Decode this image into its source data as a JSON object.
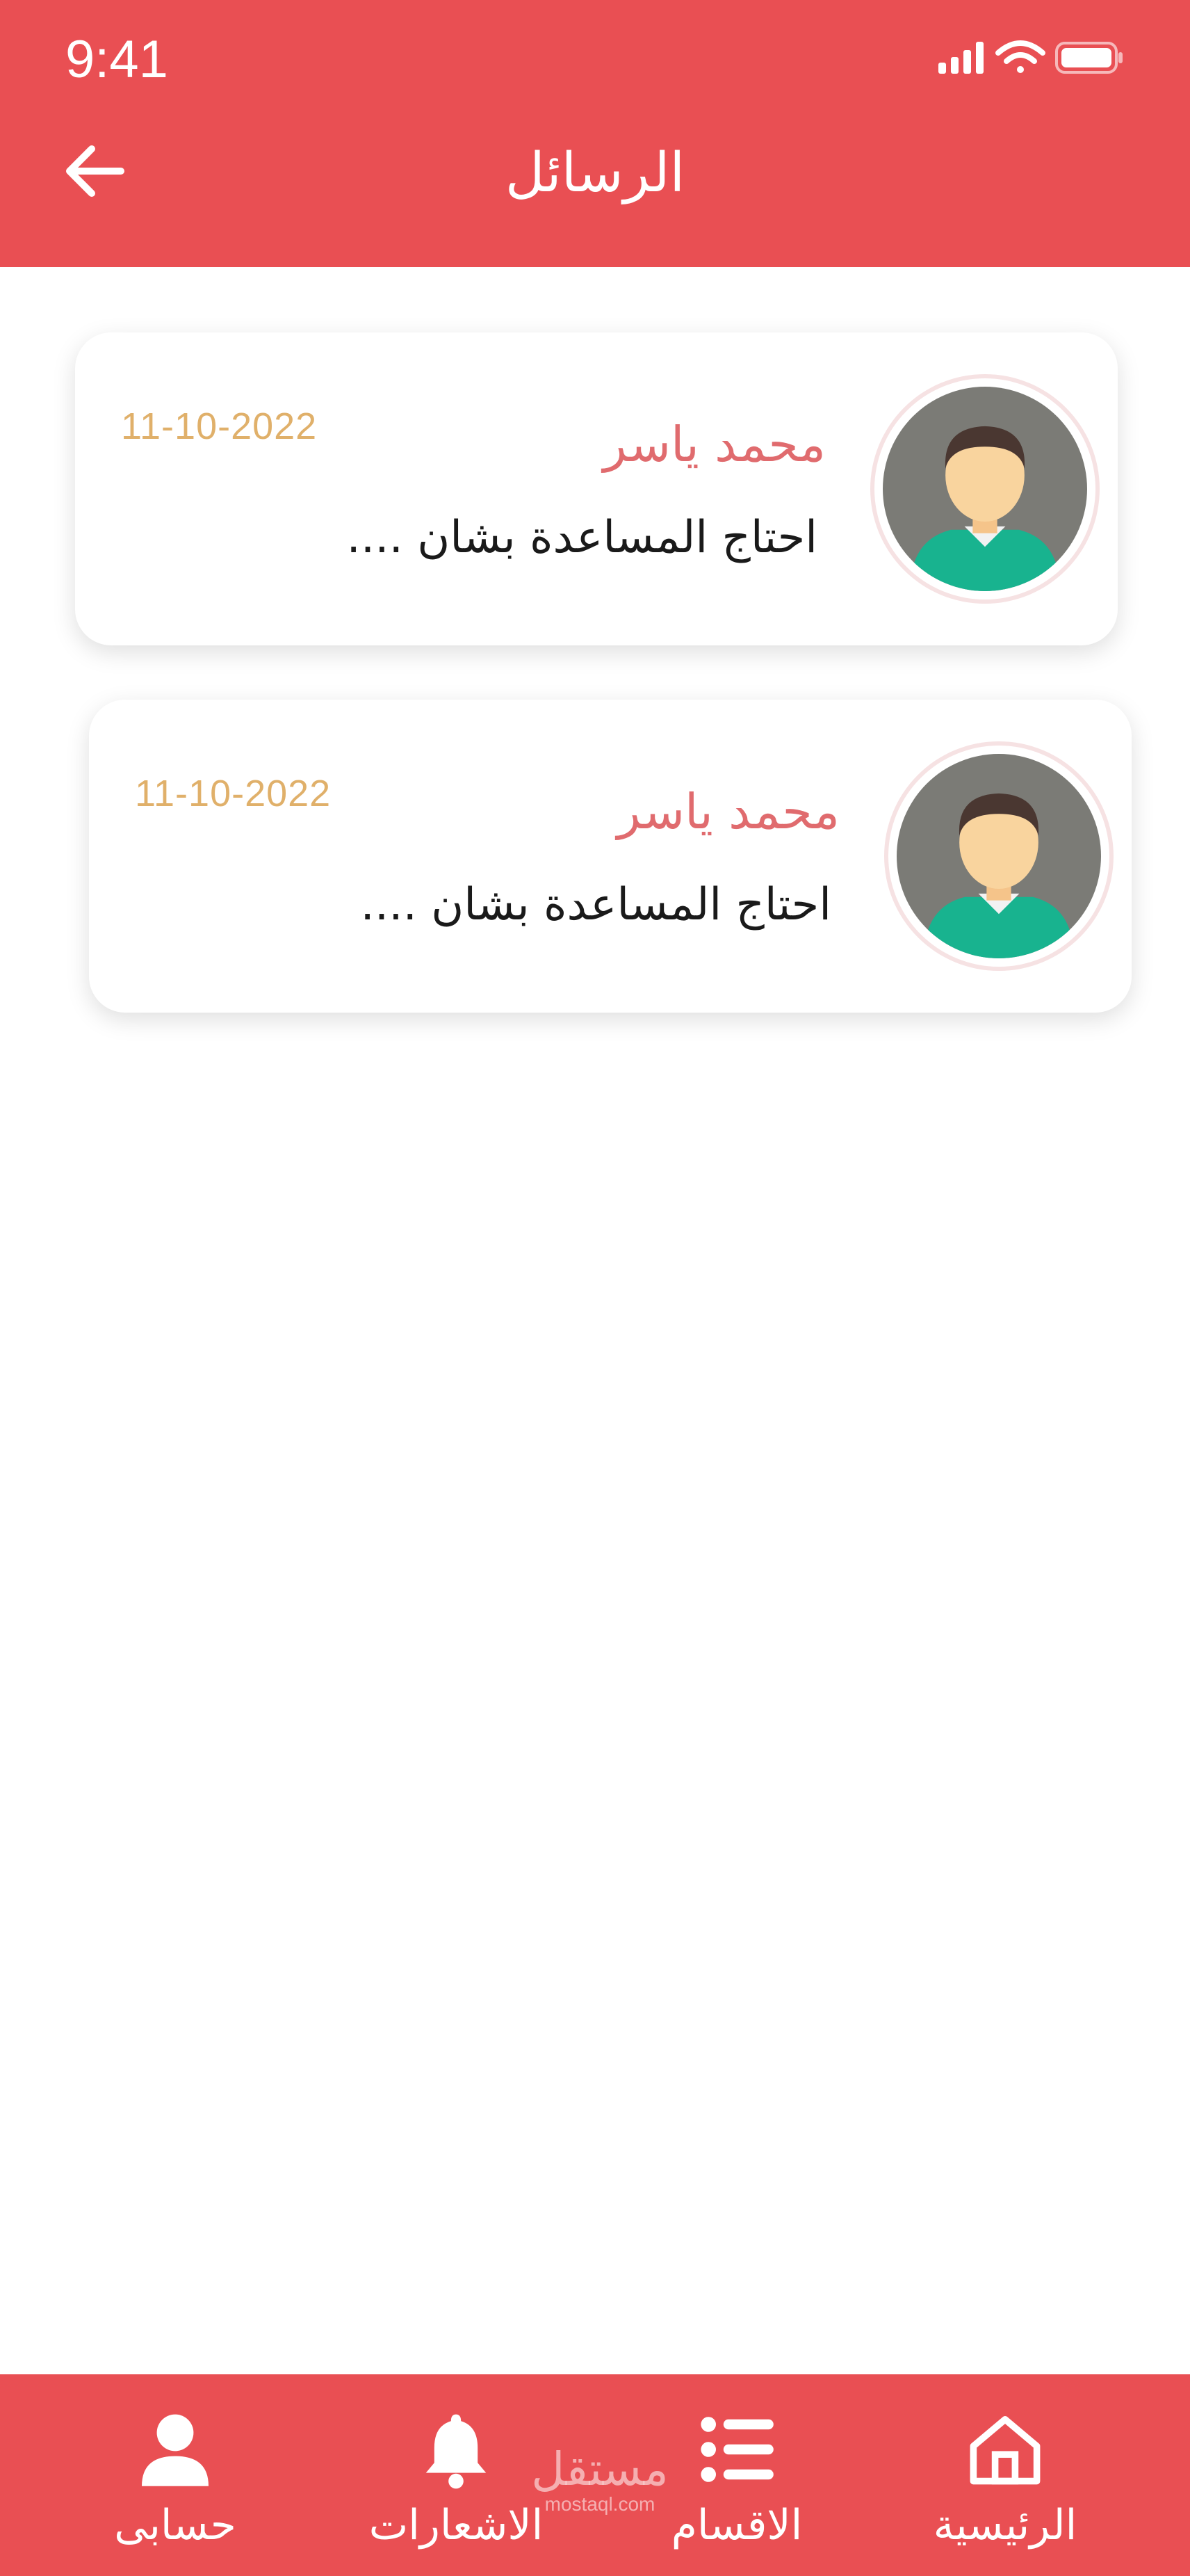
{
  "status_bar": {
    "time": "9:41"
  },
  "header": {
    "title": "الرسائل"
  },
  "messages": [
    {
      "sender": "محمد ياسر",
      "date": "11-10-2022",
      "preview": "احتاج المساعدة بشان ...."
    },
    {
      "sender": "محمد ياسر",
      "date": "11-10-2022",
      "preview": "احتاج المساعدة بشان ...."
    }
  ],
  "bottom_nav": {
    "items": [
      {
        "label": "الرئيسية",
        "icon": "home-icon"
      },
      {
        "label": "الاقسام",
        "icon": "list-icon"
      },
      {
        "label": "الاشعارات",
        "icon": "bell-icon"
      },
      {
        "label": "حسابى",
        "icon": "user-icon"
      }
    ]
  },
  "watermark": {
    "text": "مستقل",
    "subtext": "mostaql.com"
  },
  "colors": {
    "primary": "#E94F53",
    "sender": "#E06B6E",
    "date": "#E0B06A"
  }
}
